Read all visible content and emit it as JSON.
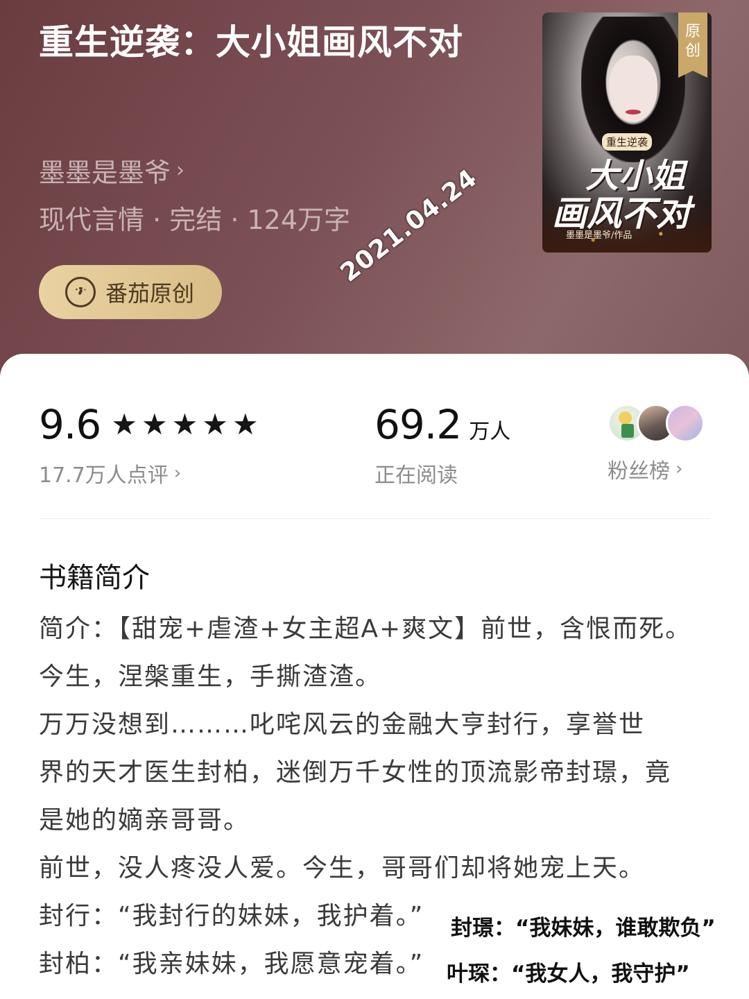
{
  "book": {
    "title": "重生逆袭：大小姐画风不对",
    "author": "墨墨是墨爷",
    "author_chevron": "›",
    "meta": "现代言情 · 完结 · 124万字",
    "badge_label": "番茄原创",
    "date_stamp": "2021.04.24"
  },
  "cover": {
    "ribbon_line1": "原",
    "ribbon_line2": "创",
    "subtitle": "重生逆袭",
    "title_line1": "大小姐",
    "title_line2": "画风不对",
    "credit": "墨墨是墨爷/作品"
  },
  "stats": {
    "rating": "9.6",
    "stars": "★★★★★",
    "rating_label": "17.7万人点评",
    "rating_chevron": "›",
    "readers": "69.2",
    "readers_unit": "万人",
    "readers_label": "正在阅读",
    "fans_label": "粉丝榜",
    "fans_chevron": "›"
  },
  "section_title": "书籍简介",
  "intro_lines": [
    "简介：【甜宠+虐渣+女主超A+爽文】前世，含恨而死。",
    "今生，涅槃重生，手撕渣渣。",
    "万万没想到………叱咤风云的金融大亨封行，享誉世",
    "界的天才医生封柏，迷倒万千女性的顶流影帝封璟，竟",
    "是她的嫡亲哥哥。",
    "前世，没人疼没人爱。今生，哥哥们却将她宠上天。",
    "封行：“我封行的妹妹，我护着。”",
    "封柏：“我亲妹妹，我愿意宠着。”"
  ],
  "overlays": {
    "line1": "封璟：“我妹妹，谁敢欺负”",
    "line2": "叶琛：“我女人，我守护”"
  },
  "colors": {
    "header_bg": "#7c5156",
    "badge_gold": "#e2c796",
    "muted_text": "#8c8c8c"
  }
}
